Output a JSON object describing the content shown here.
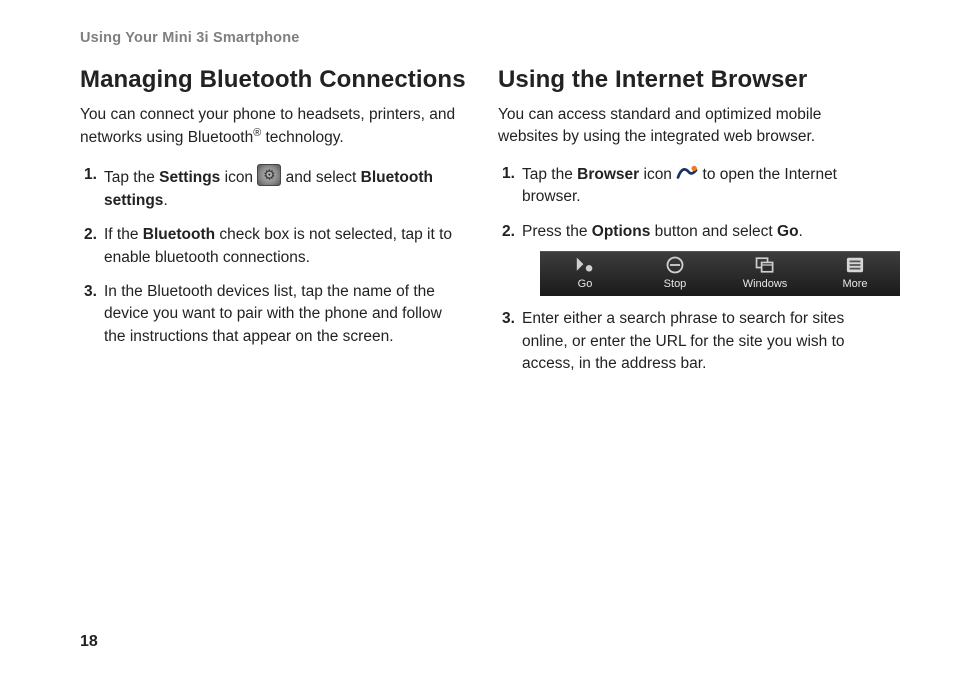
{
  "running_head": "Using Your Mini 3i Smartphone",
  "page_number": "18",
  "left": {
    "title": "Managing Bluetooth Connections",
    "intro_pre": "You can connect your phone to headsets, printers, and networks using Bluetooth",
    "intro_sup": "®",
    "intro_post": " technology.",
    "steps": {
      "1": {
        "num": "1.",
        "a": "Tap the ",
        "b": "Settings",
        "c": " icon ",
        "d": " and select ",
        "e": "Bluetooth settings",
        "f": "."
      },
      "2": {
        "num": "2.",
        "a": "If the ",
        "b": "Bluetooth",
        "c": " check box is not selected, tap it to enable bluetooth connections."
      },
      "3": {
        "num": "3.",
        "a": "In the Bluetooth devices list, tap the name of the device you want to pair with the phone and follow the instructions that appear on the screen."
      }
    }
  },
  "right": {
    "title": "Using the Internet Browser",
    "intro": "You can access standard and optimized mobile websites by using the integrated web browser.",
    "steps": {
      "1": {
        "num": "1.",
        "a": "Tap the ",
        "b": "Browser",
        "c": " icon ",
        "d": " to open the Internet browser."
      },
      "2": {
        "num": "2.",
        "a": "Press the ",
        "b": "Options",
        "c": " button and select ",
        "d": "Go",
        "e": "."
      },
      "3": {
        "num": "3.",
        "a": "Enter either a search phrase to search for sites online, or enter the URL for the site you wish to access, in the address bar."
      }
    },
    "toolbar": {
      "go": "Go",
      "stop": "Stop",
      "windows": "Windows",
      "more": "More"
    }
  }
}
